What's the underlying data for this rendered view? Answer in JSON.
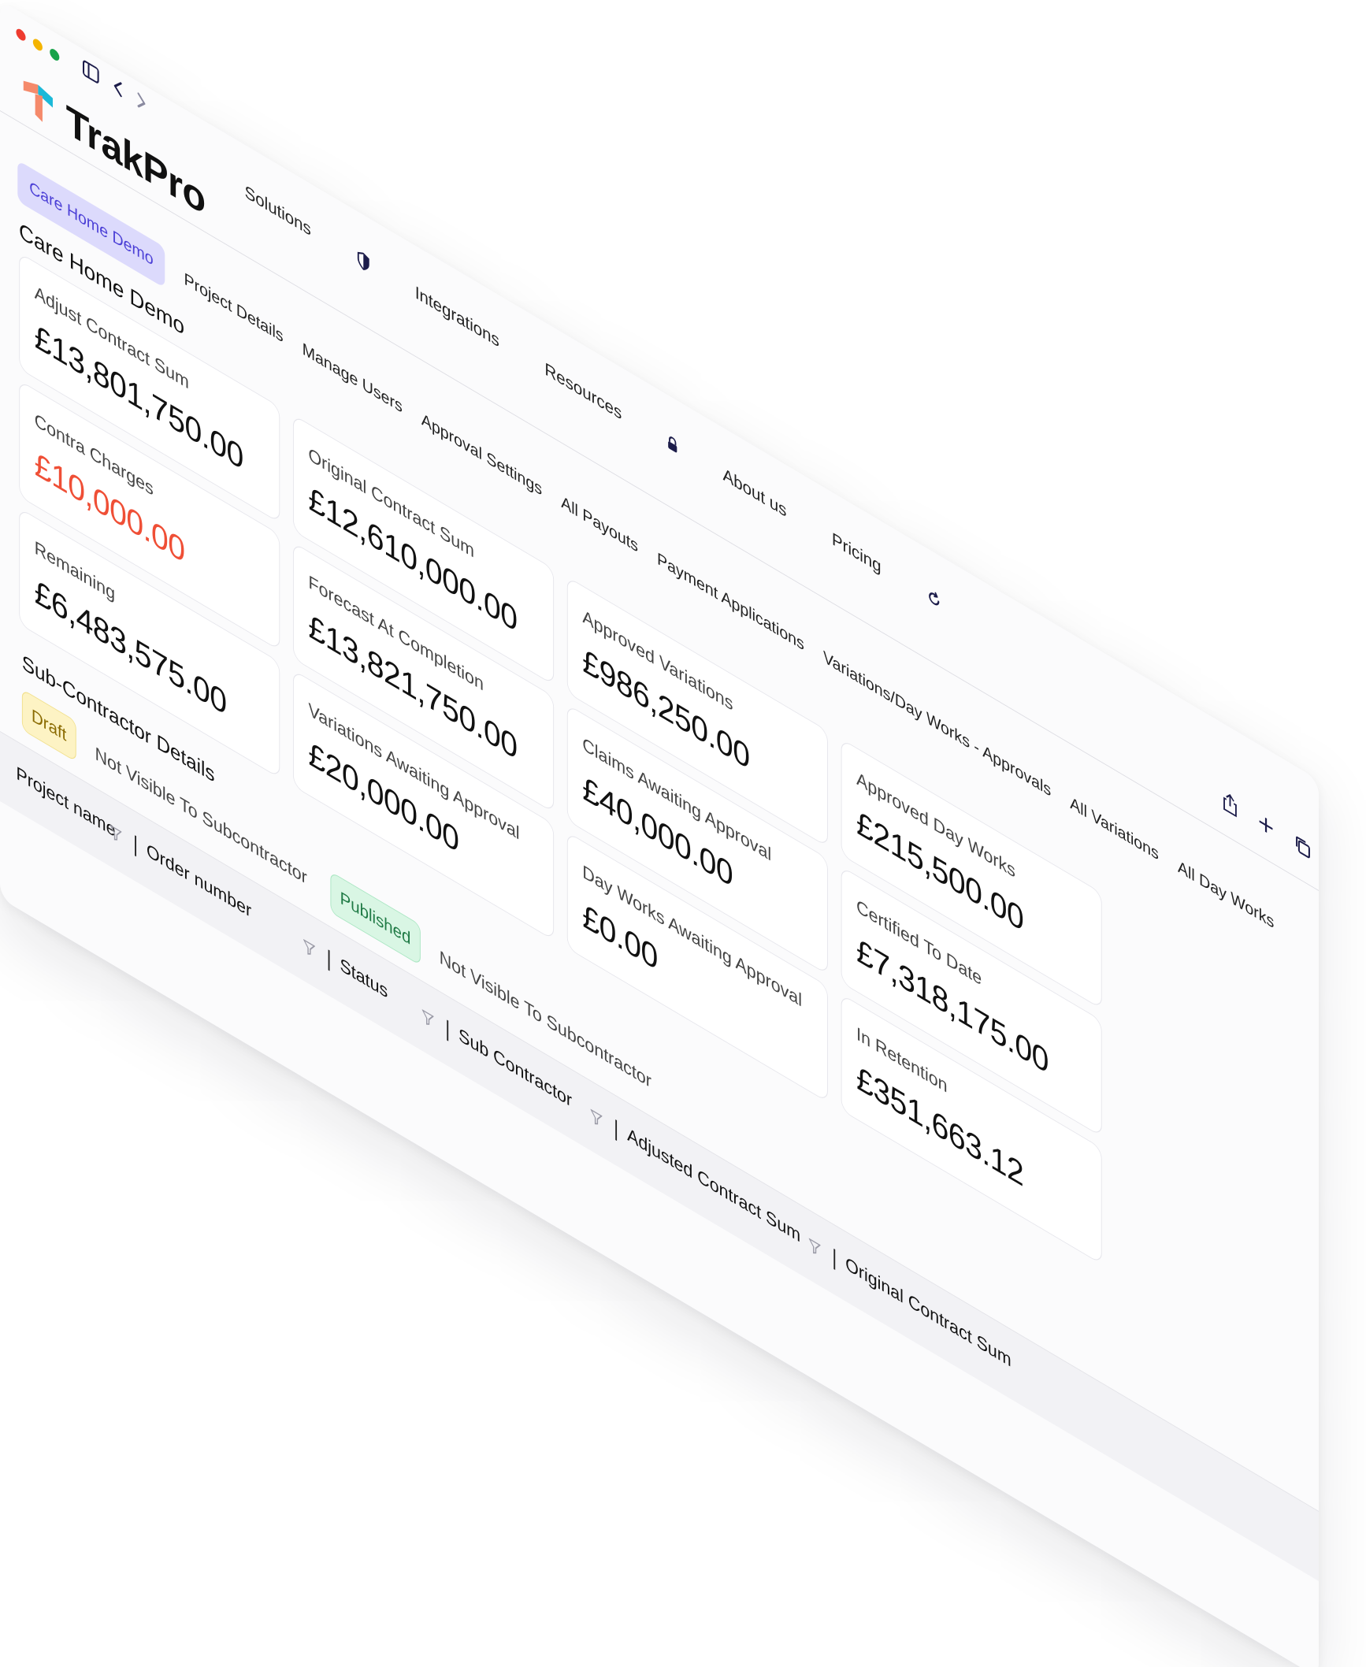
{
  "app": {
    "name": "TrakPro"
  },
  "topnav": {
    "items": [
      "Solutions",
      "Integrations",
      "Resources",
      "About us",
      "Pricing"
    ]
  },
  "tabs": {
    "active": "Care Home Demo",
    "items": [
      "Project Details",
      "Manage Users",
      "Approval Settings",
      "All Payouts",
      "Payment Applications",
      "Variations/Day Works - Approvals",
      "All Variations",
      "All Day Works"
    ]
  },
  "page": {
    "title": "Care Home Demo"
  },
  "cards": {
    "adjust_contract_sum": {
      "label": "Adjust Contract Sum",
      "value": "£13,801,750.00"
    },
    "contra_charges": {
      "label": "Contra Charges",
      "value": "£10,000.00"
    },
    "remaining": {
      "label": "Remaining",
      "value": "£6,483,575.00"
    },
    "original_contract_sum": {
      "label": "Original Contract Sum",
      "value": "£12,610,000.00"
    },
    "forecast_at_completion": {
      "label": "Forecast At Completion",
      "value": "£13,821,750.00"
    },
    "variations_awaiting_approval": {
      "label": "Variations Awaiting Approval",
      "value": "£20,000.00"
    },
    "approved_variations": {
      "label": "Approved Variations",
      "value": "£986,250.00"
    },
    "claims_awaiting_approval": {
      "label": "Claims Awaiting Approval",
      "value": "£40,000.00"
    },
    "day_works_awaiting_approval": {
      "label": "Day Works Awaiting Approval",
      "value": "£0.00"
    },
    "approved_day_works": {
      "label": "Approved Day Works",
      "value": "£215,500.00"
    },
    "certified_to_date": {
      "label": "Certified To Date",
      "value": "£7,318,175.00"
    },
    "in_retention": {
      "label": "In Retention",
      "value": "£351,663.12"
    }
  },
  "subcontractor": {
    "title": "Sub-Contractor Details",
    "statuses": [
      {
        "badge": "Draft",
        "text": "Not Visible To Subcontractor"
      },
      {
        "badge": "Published",
        "text": "Not Visible To Subcontractor"
      }
    ]
  },
  "table": {
    "columns": [
      "Project name",
      "Order number",
      "Status",
      "Sub Contractor",
      "Adjusted Contract Sum",
      "Original Contract Sum"
    ]
  },
  "colors": {
    "accent": "#4b3fd6",
    "accent_bg": "#dcdafc",
    "negative": "#ef4f36",
    "draft_bg": "#fdf3c4",
    "published_bg": "#d9f6e4"
  },
  "icons": [
    "sidebar-toggle-icon",
    "back-icon",
    "forward-icon",
    "shield-icon",
    "lock-icon",
    "refresh-icon",
    "share-icon",
    "plus-icon",
    "copy-icon",
    "filter-icon"
  ]
}
